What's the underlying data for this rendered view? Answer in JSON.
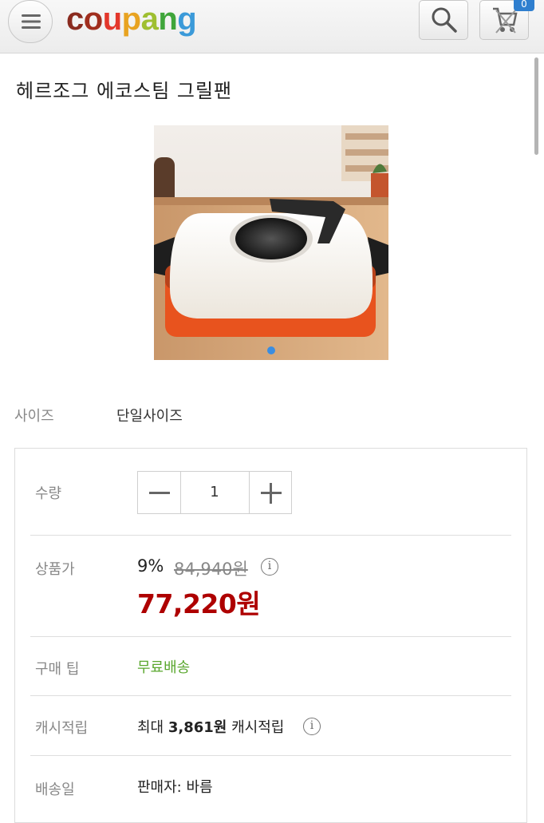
{
  "header": {
    "logo": [
      "c",
      "o",
      "u",
      "p",
      "a",
      "n",
      "g"
    ],
    "cart_count": "0",
    "icons": [
      "menu-icon",
      "search-icon",
      "cart-icon"
    ]
  },
  "product": {
    "title": "헤르조그 에코스팀 그릴팬",
    "image_description_icon": "grill-pan-photo"
  },
  "options": {
    "size_label": "사이즈",
    "size_value": "단일사이즈"
  },
  "details": {
    "quantity_label": "수량",
    "quantity_value": "1",
    "price_label": "상품가",
    "discount_rate": "9%",
    "original_price": "84,940원",
    "sale_price": "77,220원",
    "tip_label": "구매 팁",
    "tip_value": "무료배송",
    "cash_label": "캐시적립",
    "cash_prefix": "최대",
    "cash_amount": "3,861원",
    "cash_suffix": "캐시적립",
    "delivery_label": "배송일",
    "seller_text": "판매자: 바름"
  },
  "colors": {
    "sale_price": "#ae0000",
    "free_shipping": "#5aa72e",
    "image_indicator": "#3b8de0"
  }
}
